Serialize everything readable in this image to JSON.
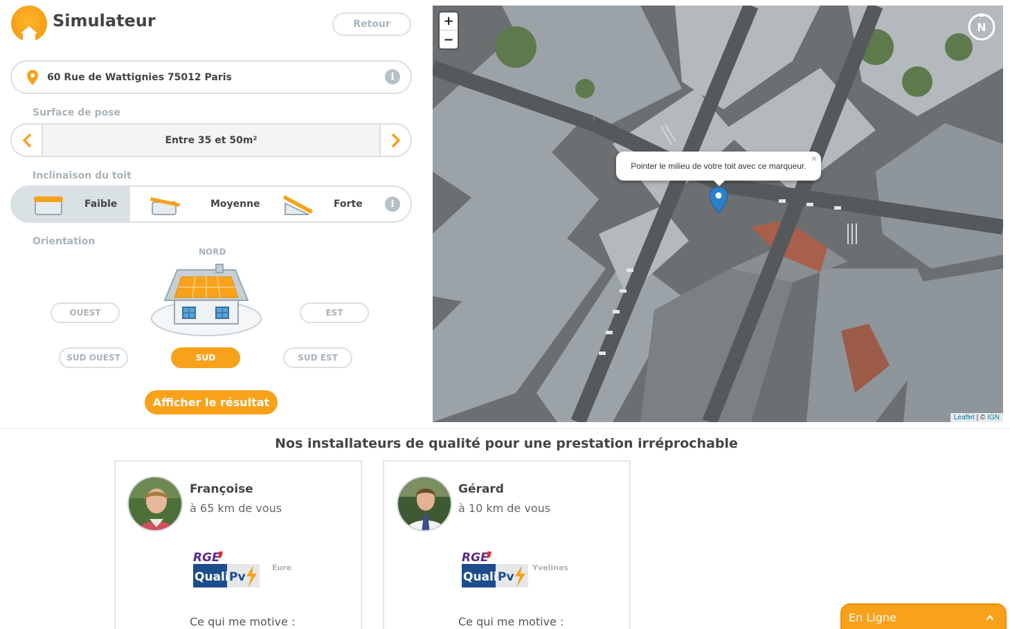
{
  "header": {
    "title": "Simulateur",
    "back_label": "Retour"
  },
  "address": {
    "value": "60 Rue de Wattignies 75012 Paris",
    "icon": "map-pin-icon"
  },
  "surface": {
    "label": "Surface de pose",
    "value": "Entre 35 et 50m²"
  },
  "inclinaison": {
    "label": "Inclinaison du toit",
    "options": [
      {
        "label": "Faible",
        "selected": true
      },
      {
        "label": "Moyenne",
        "selected": false
      },
      {
        "label": "Forte",
        "selected": false
      }
    ]
  },
  "orientation": {
    "label": "Orientation",
    "north_label": "NORD",
    "buttons": [
      {
        "key": "ouest",
        "label": "OUEST",
        "selected": false
      },
      {
        "key": "est",
        "label": "EST",
        "selected": false
      },
      {
        "key": "sud_ouest",
        "label": "SUD OUEST",
        "selected": false
      },
      {
        "key": "sud",
        "label": "SUD",
        "selected": true
      },
      {
        "key": "sud_est",
        "label": "SUD EST",
        "selected": false
      }
    ]
  },
  "result_button": "Afficher le résultat",
  "map": {
    "zoom_in": "+",
    "zoom_out": "−",
    "compass_letter": "N",
    "popup_text": "Pointer le milieu de votre toit avec ce marqueur.",
    "popup_close": "×",
    "attribution_link": "Leaflet",
    "attribution_sep": " | © ",
    "attribution_link2": "IGN"
  },
  "installers": {
    "title": "Nos installateurs de qualité pour une prestation irréprochable",
    "cards": [
      {
        "name": "Françoise",
        "distance": "à 65 km de vous",
        "region": "Eure",
        "motive": "Ce qui me motive :"
      },
      {
        "name": "Gérard",
        "distance": "à 10 km de vous",
        "region": "Yvelines",
        "motive": "Ce qui me motive :"
      }
    ],
    "badge": {
      "line1": "RGE",
      "line2": "Quali",
      "line3": "Pv"
    }
  },
  "chat": {
    "label": "En Ligne"
  },
  "colors": {
    "accent": "#f7a21a",
    "border": "#d9dfe3",
    "muted": "#a9b3ba",
    "text": "#444444"
  }
}
